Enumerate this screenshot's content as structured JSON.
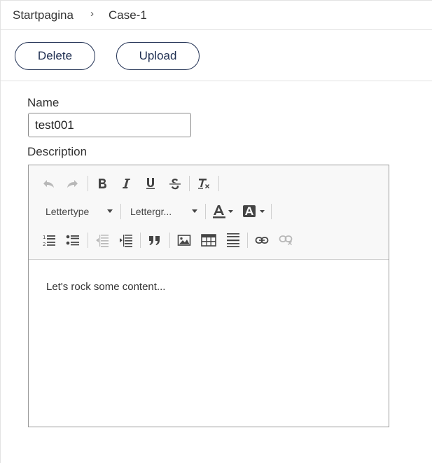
{
  "breadcrumb": {
    "home": "Startpagina",
    "separator": "›",
    "current": "Case-1"
  },
  "actions": {
    "delete_label": "Delete",
    "upload_label": "Upload"
  },
  "form": {
    "name_label": "Name",
    "name_value": "test001",
    "description_label": "Description"
  },
  "editor": {
    "font_family_placeholder": "Lettertype",
    "font_size_placeholder": "Lettergr...",
    "content": "Let's rock some content...",
    "toolbar_icons": [
      "undo-icon",
      "redo-icon",
      "bold-icon",
      "italic-icon",
      "underline-icon",
      "strikethrough-icon",
      "clear-format-icon",
      "text-color-icon",
      "background-color-icon",
      "numbered-list-icon",
      "bullet-list-icon",
      "outdent-icon",
      "indent-icon",
      "blockquote-icon",
      "image-icon",
      "table-icon",
      "horizontal-rule-icon",
      "link-icon",
      "unlink-icon"
    ]
  },
  "colors": {
    "button_border": "#1f2f52",
    "toolbar_bg": "#f8f8f8",
    "disabled_icon": "#b8b8b8"
  }
}
